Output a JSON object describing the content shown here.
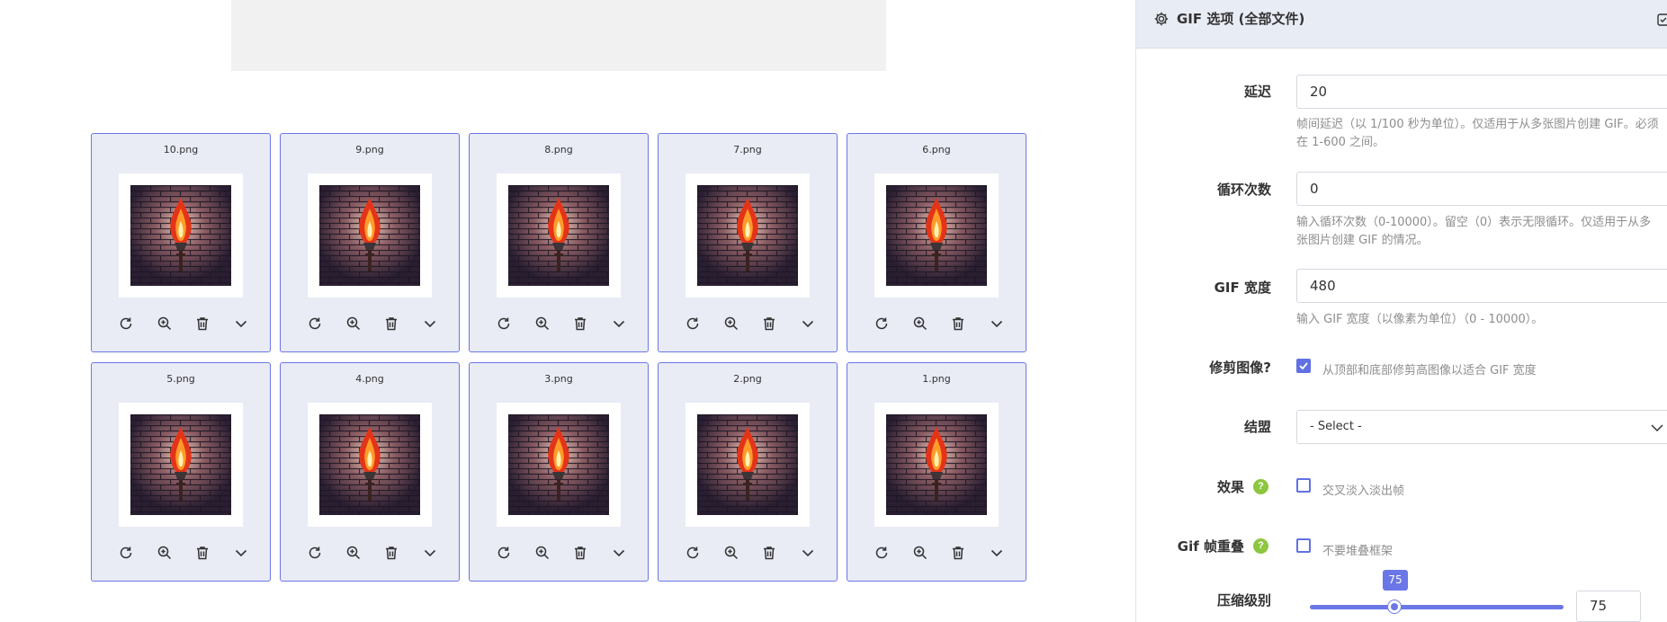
{
  "files": [
    {
      "name": "10.png"
    },
    {
      "name": "9.png"
    },
    {
      "name": "8.png"
    },
    {
      "name": "7.png"
    },
    {
      "name": "6.png"
    },
    {
      "name": "5.png"
    },
    {
      "name": "4.png"
    },
    {
      "name": "3.png"
    },
    {
      "name": "2.png"
    },
    {
      "name": "1.png"
    }
  ],
  "card_actions": [
    "rotate-icon",
    "zoom-in-icon",
    "trash-icon",
    "chevron-down-icon"
  ],
  "panel": {
    "title": "GIF 选项 (全部文件)",
    "delay": {
      "label": "延迟",
      "value": "20",
      "help": "帧间延迟（以 1/100 秒为单位）。仅适用于从多张图片创建 GIF。必须在 1-600 之间。"
    },
    "loop": {
      "label": "循环次数",
      "value": "0",
      "help": "输入循环次数（0-10000）。留空（0）表示无限循环。仅适用于从多张图片创建 GIF 的情况。"
    },
    "width": {
      "label": "GIF 宽度",
      "value": "480",
      "help": "输入 GIF 宽度（以像素为单位）（0 - 10000）。"
    },
    "crop": {
      "label": "修剪图像?",
      "checked": true,
      "option": "从顶部和底部修剪高图像以适合 GIF 宽度"
    },
    "alliance": {
      "label": "结盟",
      "value": "- Select -"
    },
    "effect": {
      "label": "效果",
      "help_badge": "?",
      "checked": false,
      "option": "交叉淡入淡出帧"
    },
    "overlap": {
      "label": "Gif 帧重叠",
      "help_badge": "?",
      "checked": false,
      "option": "不要堆叠框架"
    },
    "compression": {
      "label": "压缩级别",
      "value": "75",
      "bubble": "75",
      "fraction": 0.75
    }
  },
  "colors": {
    "accent": "#6b77e6",
    "card_bg": "#e9ebf5",
    "help_badge": "#8dc63f"
  }
}
